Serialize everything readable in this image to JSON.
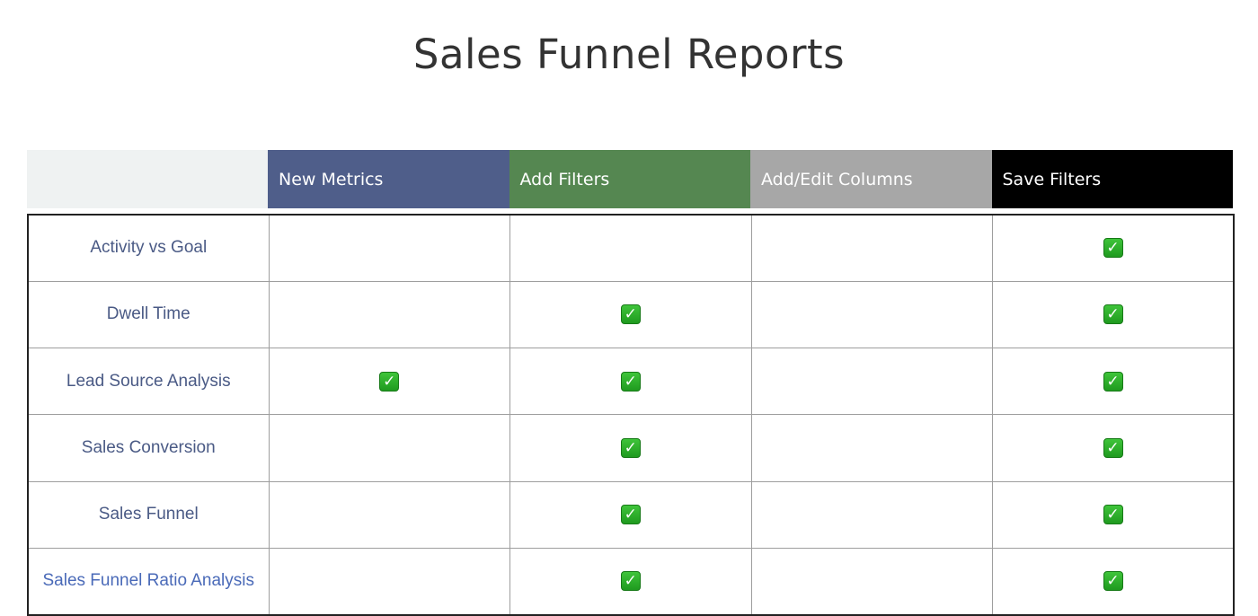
{
  "title": "Sales Funnel Reports",
  "header": {
    "columns": [
      {
        "label": "New Metrics",
        "bg": "#4f5e8a",
        "fg": "#ffffff"
      },
      {
        "label": "Add Filters",
        "bg": "#558751",
        "fg": "#ffffff"
      },
      {
        "label": "Add/Edit Columns",
        "bg": "#a7a7a7",
        "fg": "#ffffff"
      },
      {
        "label": "Save Filters",
        "bg": "#000000",
        "fg": "#ffffff"
      }
    ],
    "corner_bg": "#eff2f2"
  },
  "rows": [
    {
      "label": "Activity vs Goal",
      "label_color": "#4a5a85",
      "checks": [
        false,
        false,
        false,
        true
      ]
    },
    {
      "label": "Dwell Time",
      "label_color": "#4a5a85",
      "checks": [
        false,
        true,
        false,
        true
      ]
    },
    {
      "label": "Lead Source Analysis",
      "label_color": "#4a5a85",
      "checks": [
        true,
        true,
        false,
        true
      ]
    },
    {
      "label": "Sales Conversion",
      "label_color": "#4a5a85",
      "checks": [
        false,
        true,
        false,
        true
      ]
    },
    {
      "label": "Sales Funnel",
      "label_color": "#4a5a85",
      "checks": [
        false,
        true,
        false,
        true
      ]
    },
    {
      "label": "Sales Funnel Ratio Analysis",
      "label_color": "#4a6ab8",
      "checks": [
        false,
        true,
        false,
        true
      ]
    }
  ],
  "check_icon": "white-heavy-check-mark-icon",
  "check_glyph": "✓"
}
